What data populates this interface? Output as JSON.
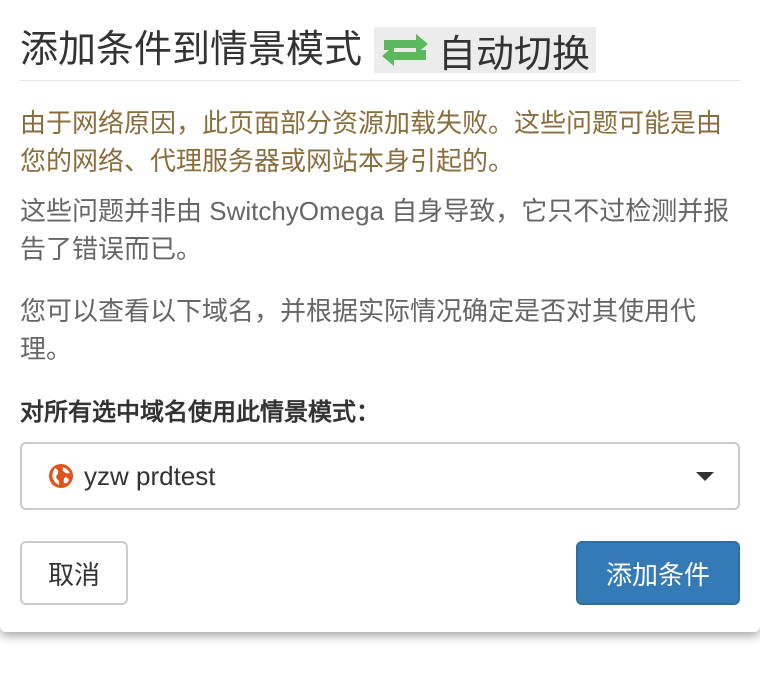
{
  "dialog": {
    "title": "添加条件到情景模式",
    "profile_name": "自动切换",
    "profile_icon": "repeat-icon",
    "profile_icon_color": "#5cb85c",
    "warning_text": "由于网络原因，此页面部分资源加载失败。这些问题可能是由您的网络、代理服务器或网站本身引起的。",
    "info_text_1": "这些问题并非由 SwitchyOmega 自身导致，它只不过检测并报告了错误而已。",
    "info_text_2": "您可以查看以下域名，并根据实际情况确定是否对其使用代理。",
    "select_label": "对所有选中域名使用此情景模式：",
    "selected_profile": "yzw prdtest",
    "selected_profile_icon": "globe-icon",
    "selected_profile_color": "#e0541e",
    "cancel_label": "取消",
    "add_label": "添加条件"
  }
}
